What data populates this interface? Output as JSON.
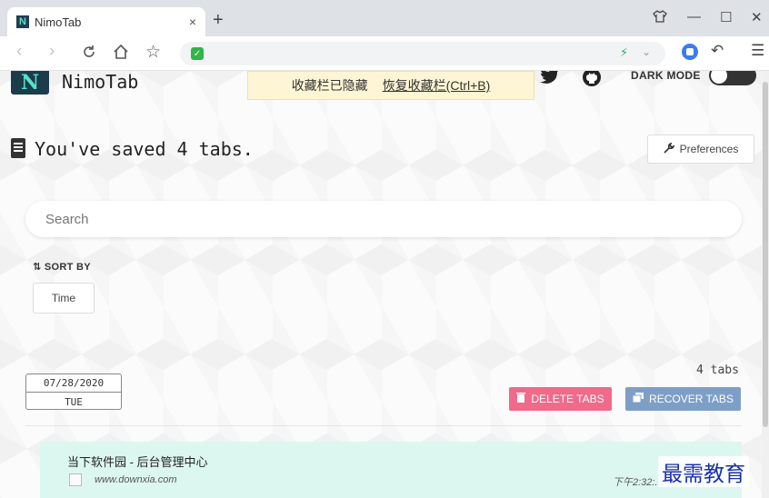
{
  "browser": {
    "tab_title": "NimoTab",
    "tab_close": "×",
    "new_tab": "+",
    "window_controls": [
      "🗑",
      "—",
      "☐",
      "✕"
    ],
    "nav": {
      "back": "‹",
      "forward": "›",
      "reload": "C",
      "home": "⌂",
      "star": "☆"
    },
    "address_icons": [
      "shield-icon",
      "bolt-icon",
      "caret-icon"
    ],
    "toolbar_icons": [
      "extension-icon",
      "undo-icon",
      "menu-icon"
    ]
  },
  "header": {
    "logo_text": "N",
    "brand": "NimoTab",
    "notice_text": "收藏栏已隐藏",
    "notice_link": "恢复收藏栏(Ctrl+B)",
    "dark_mode_label": "DARK MODE"
  },
  "main": {
    "saved_title": "You've saved 4 tabs.",
    "preferences_label": "Preferences",
    "search_placeholder": "Search",
    "sort_by_label": "⇅ SORT BY",
    "sort_option": "Time"
  },
  "group": {
    "date": "07/28/2020",
    "weekday": "TUE",
    "tab_count": "4 tabs",
    "delete_label": "DELETE TABS",
    "recover_label": "RECOVER TABS",
    "items": [
      {
        "title": "当下软件园 - 后台管理中心",
        "url": "www.downxia.com",
        "time": "下午2:32:..."
      }
    ]
  },
  "watermark": "最需教育",
  "colors": {
    "accent_teal": "#56e3c6",
    "delete": "#f06a8a",
    "recover": "#7d9fc7",
    "row_bg": "#dcf7ef"
  }
}
